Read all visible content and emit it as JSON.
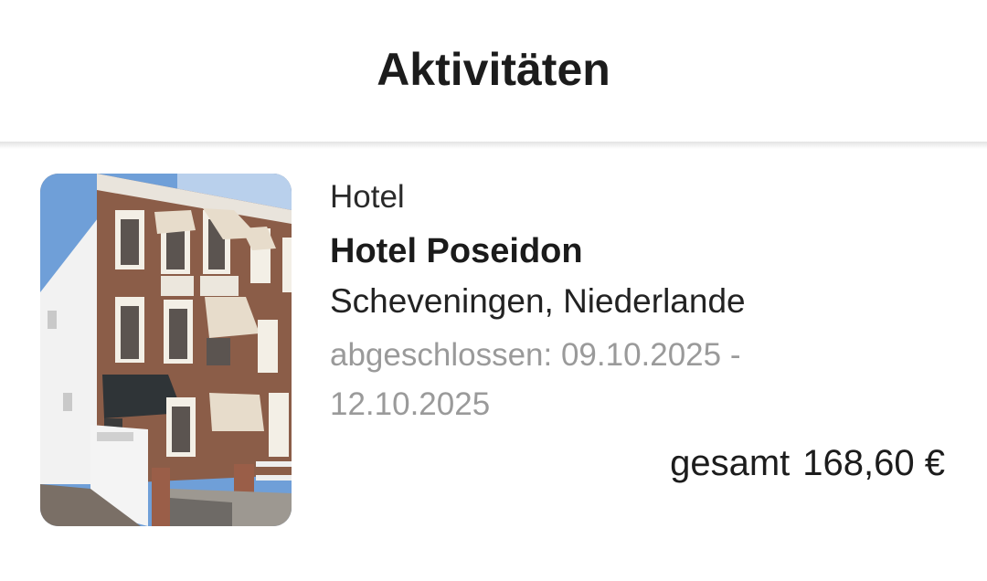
{
  "header": {
    "title": "Aktivitäten"
  },
  "activity": {
    "category": "Hotel",
    "name": "Hotel Poseidon",
    "location": "Scheveningen, Niederlande",
    "status_dates": "abgeschlossen: 09.10.2025 - 12.10.2025",
    "total_label": "gesamt",
    "total_amount": "168,60 €",
    "image": "hotel-building-photo"
  },
  "colors": {
    "title": "#1c1c1c",
    "secondary_text": "#9a9a9a",
    "divider_shadow": "#e3e3e3"
  }
}
